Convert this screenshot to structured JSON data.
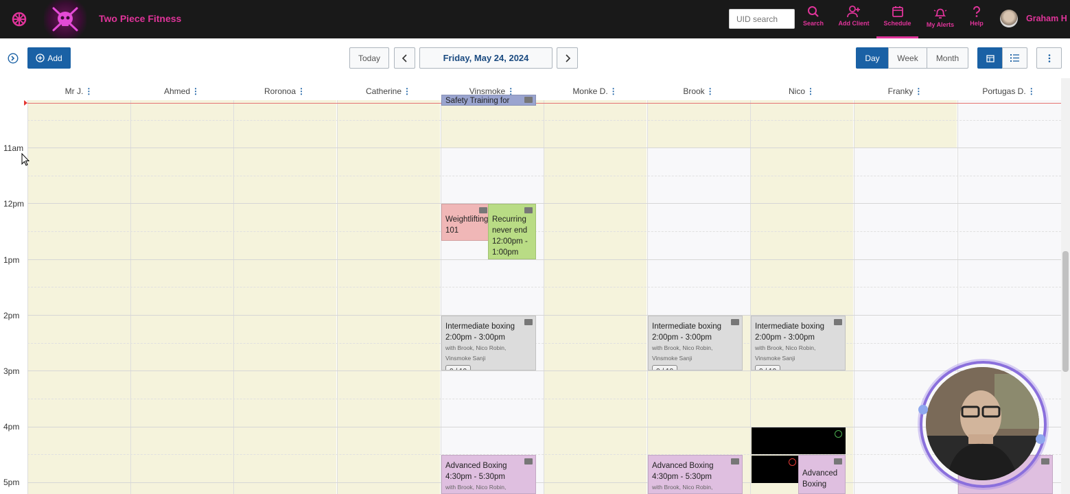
{
  "brand": {
    "name": "Two Piece Fitness",
    "accent": "#e0349a"
  },
  "header": {
    "uid_search_placeholder": "UID search",
    "nav": [
      {
        "label": "Search",
        "icon": "search-icon"
      },
      {
        "label": "Add Client",
        "icon": "add-user-icon"
      },
      {
        "label": "Schedule",
        "icon": "calendar-icon",
        "active": true
      },
      {
        "label": "My Alerts",
        "icon": "bell-icon"
      },
      {
        "label": "Help",
        "icon": "help-icon"
      }
    ],
    "user_name": "Graham H"
  },
  "toolbar": {
    "add_label": "Add",
    "today_label": "Today",
    "date_label": "Friday, May 24, 2024",
    "views": [
      "Day",
      "Week",
      "Month"
    ],
    "active_view": "Day"
  },
  "columns": [
    "Mr J.",
    "Ahmed",
    "Roronoa",
    "Catherine",
    "Vinsmoke",
    "Monke D.",
    "Brook",
    "Nico",
    "Franky",
    "Portugas D."
  ],
  "hours": [
    "11am",
    "12pm",
    "1pm",
    "2pm",
    "3pm",
    "4pm",
    "5pm"
  ],
  "events": {
    "safety": {
      "title": "Safety Training for"
    },
    "weightlifting": {
      "title": "Weightlifting 101"
    },
    "recurring": {
      "title": "Recurring never end",
      "time": "12:00pm - 1:00pm"
    },
    "intermediate": {
      "title": "Intermediate boxing",
      "time": "2:00pm - 3:00pm",
      "with": "with Brook, Nico Robin, Vinsmoke Sanji",
      "count": "0 / 10"
    },
    "advanced": {
      "title": "Advanced Boxing",
      "time": "4:30pm - 5:30pm",
      "with": "with Brook, Nico Robin,"
    },
    "advanced_short": {
      "title": "Advanced Boxing"
    }
  },
  "colors": {
    "unavailable": "#f5f3dc",
    "weightlifting": "#f0b7b7",
    "recurring": "#b9dc85",
    "boxing": "#dcdcdc",
    "advanced": "#dfbfe0",
    "safety": "#9aa4cf",
    "now_line": "#e57373"
  }
}
